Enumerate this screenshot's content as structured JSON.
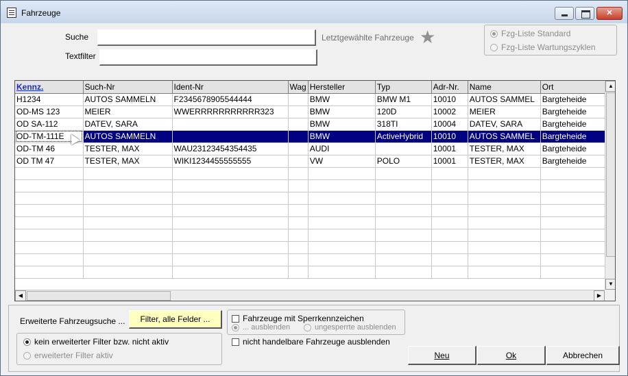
{
  "window": {
    "title": "Fahrzeuge"
  },
  "search": {
    "suche_label": "Suche",
    "suche_value": "",
    "textfilter_label": "Textfilter",
    "textfilter_value": "",
    "recent_label": "Letztgewählte Fahrzeuge"
  },
  "list_mode": {
    "options": [
      "Fzg-Liste Standard",
      "Fzg-Liste Wartungszyklen"
    ],
    "selected": "Fzg-Liste Standard"
  },
  "grid": {
    "columns": [
      "Kennz.",
      "Such-Nr",
      "Ident-Nr",
      "Wag",
      "Hersteller",
      "Typ",
      "Adr-Nr.",
      "Name",
      "Ort"
    ],
    "sorted_column": "Kennz.",
    "rows": [
      [
        "H1234",
        "AUTOS SAMMELN",
        "F2345678905544444",
        "",
        "BMW",
        "BMW M1",
        "10010",
        "AUTOS SAMMEL",
        "Bargteheide"
      ],
      [
        "OD-MS 123",
        "MEIER",
        "WWERRRRRRRRRRR323",
        "",
        "BMW",
        "120D",
        "10002",
        "MEIER",
        "Bargteheide"
      ],
      [
        "OD SA-112",
        "DATEV, SARA",
        "",
        "",
        "BMW",
        "318TI",
        "10004",
        "DATEV, SARA",
        "Bargteheide"
      ],
      [
        "OD-TM-111E",
        "AUTOS SAMMELN",
        "",
        "",
        "BMW",
        "ActiveHybrid",
        "10010",
        "AUTOS SAMMEL",
        "Bargteheide"
      ],
      [
        "OD-TM 46",
        "TESTER, MAX",
        "WAU23123454354435",
        "",
        "AUDI",
        "",
        "10001",
        "TESTER, MAX",
        "Bargteheide"
      ],
      [
        "OD TM 47",
        "TESTER, MAX",
        "WIKI1234455555555",
        "",
        "VW",
        "POLO",
        "10001",
        "TESTER, MAX",
        "Bargteheide"
      ]
    ],
    "selected_row": 3
  },
  "extended": {
    "label": "Erweiterte Fahrzeugsuche ...",
    "filter_button": "Filter, alle Felder ...",
    "options": [
      "kein erweiterter Filter bzw. nicht aktiv",
      "erweiterter Filter aktiv"
    ],
    "selected": "kein erweiterter Filter bzw. nicht aktiv"
  },
  "sperr": {
    "checkbox_label": "Fahrzeuge mit Sperrkennzeichen",
    "checked": false,
    "options": [
      "... ausblenden",
      "ungesperrte ausblenden"
    ],
    "selected": "... ausblenden"
  },
  "handel": {
    "checkbox_label": "nicht handelbare Fahrzeuge ausblenden",
    "checked": false
  },
  "buttons": {
    "new": "Neu",
    "ok": "Ok",
    "cancel": "Abbrechen"
  }
}
